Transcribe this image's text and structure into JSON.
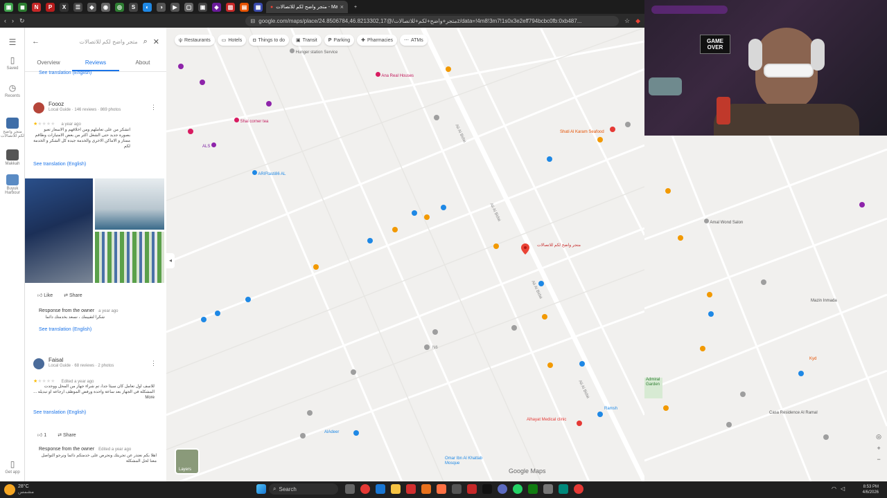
{
  "browser": {
    "active_tab_title": "متجر واضح لكم للاتصالات - Maps",
    "url": "google.com/maps/place/متجر+واضح+لكم+للاتصالات/@24.8506784,46.8213302,17z/data=!4m8!3m7!1s0x3e2eff794bcbc0fb:0xb487..."
  },
  "rail": {
    "saved": "Saved",
    "recents": "Recents",
    "place1": "متجر واضح لكم للاتصالات",
    "place2": "Makkah",
    "place3": "Buyuk Harbour",
    "get_app": "Get app"
  },
  "panel": {
    "search_value": "متجر واضح لكم للاتصالات",
    "tabs": [
      "Overview",
      "Reviews",
      "About"
    ],
    "see_translation": "See translation (English)",
    "review1": {
      "name": "Foooz",
      "meta": "Local Guide · 146 reviews · 869 photos",
      "rating": 1,
      "when": "a year ago",
      "text": "اتشكر من على تعاملهم ومن اخلاقهم و الاسعار تعبو بصورة جديد حتى الشغل اكثر من بعض الامتيازات وطاقم ممتاز و الاماكن الاخرى والخدمة جيدة كل الشكر و الخدمة لكم",
      "see_translation": "See translation (English)",
      "like": "Like",
      "share": "Share",
      "response_label": "Response from the owner",
      "response_when": "a year ago",
      "response_text": "شكرا لتقييمك ، نسعد بخدمتك دائما",
      "response_translation": "See translation (English)"
    },
    "review2": {
      "name": "Faisal",
      "meta": "Local Guide · 68 reviews · 2 photos",
      "rating": 1,
      "when": "Edited a year ago",
      "text": "للاسف اول تعامل كان سيئا جدا، تم شراء جهاز من المحل ووجدت المشكلة في الجهاز بعد ساعة واحدة ورفض الموظف ارجاعه او تبديله ... More",
      "see_translation": "See translation (English)",
      "like_count": "1",
      "share": "Share",
      "response_label": "Response from the owner",
      "response_when": "Edited a year ago",
      "response_text": "اهلا بكم نعتذر عن تجربتك ونحرص على خدمتكم دائما ونرجو التواصل معنا لحل المشكلة"
    }
  },
  "map": {
    "chips": [
      "Restaurants",
      "Hotels",
      "Things to do",
      "Transit",
      "Parking",
      "Pharmacies",
      "ATMs"
    ],
    "pois": {
      "hunger": "Hunger station Service",
      "ana_real": "Ana Real Houses",
      "shai": "Shai corner tea",
      "als": "ALS",
      "arif": "ARIFtasti86 AL",
      "store": "متجر واضح لكم للاتصالات",
      "shati": "Shati Al Karam Seafood",
      "omar": "Omar Ibn Al Khattab Mosque",
      "alhayat": "Alhayat Medical clinic",
      "ramsh": "Ramsh",
      "alkhair": "Alkhair",
      "adeer": "AlAdeer",
      "n6": "N6",
      "amal": "Amal Wond Salon",
      "mazin": "Mazin Inmada",
      "casa": "Casa Residence Al Ramal",
      "admiral": "Admiral Garden",
      "kyd": "Kyd"
    },
    "streets": {
      "albidi1": "Ali Al Bidai",
      "albidi2": "Ali Al Bidai",
      "albidi3": "Ali Al Bidai",
      "albidi4": "Ali Al Bidai"
    },
    "logo": "Google Maps",
    "layers": "Layers"
  },
  "webcam": {
    "label": "GAME OVER"
  },
  "taskbar": {
    "temp": "28°C",
    "condition": "مشمس",
    "search": "Search",
    "time": "8:53 PM",
    "date": "4/6/2026"
  }
}
